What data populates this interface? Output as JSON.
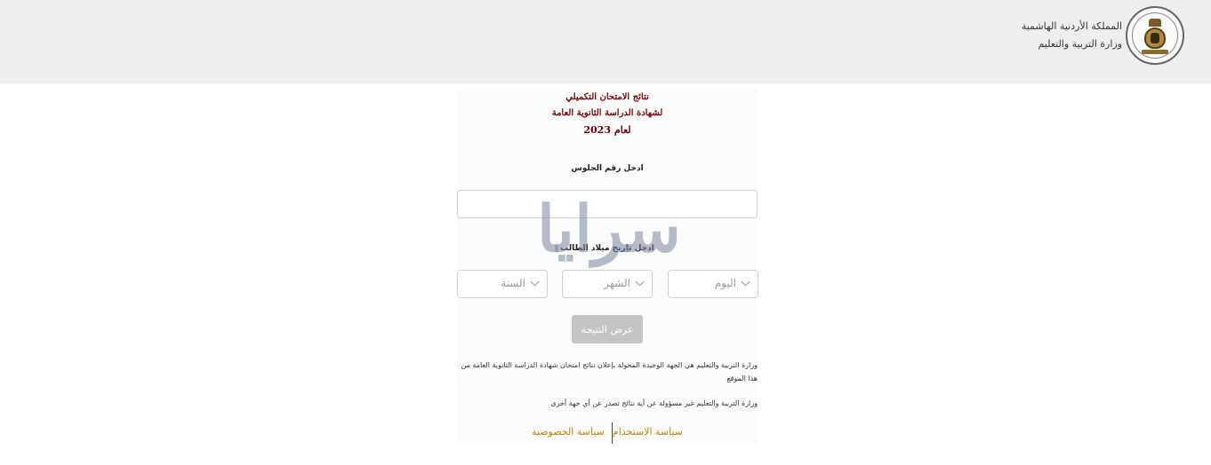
{
  "header": {
    "org_line1": "المملكة الأردنية الهاشمية",
    "org_line2": "وزارة التربية والتعليم"
  },
  "title": {
    "line1": "نتائج الامتحان التكميلي",
    "line2": "لشهادة الدراسة الثانوية العامة",
    "line3": "لعام 2023"
  },
  "form": {
    "seat_label": "ادخل رقم الجلوس",
    "seat_value": "",
    "dob_label": "ادخل تاريخ ميلاد الطالب",
    "day_placeholder": "اليوم",
    "month_placeholder": "الشهر",
    "year_placeholder": "السنة",
    "submit_label": "عرض النتيجة"
  },
  "notes": {
    "note1": "وزارة التربية والتعليم هي الجهة الوحيدة المخولة بإعلان نتائج امتحان شهادة الدراسة الثانوية العامة من هذا الموقع",
    "note2": "وزارة التربية والتعليم غير مسؤولة عن أية نتائج تصدر عن أي جهة أخرى"
  },
  "footer": {
    "terms_link": "سياسة الاستخدام",
    "privacy_link": "سياسة الخصوصية"
  },
  "watermark": "سرايا",
  "colors": {
    "title": "#7a0a0a",
    "link": "#b8860b",
    "header_bg": "#eeeeee",
    "button_bg": "#c4c4c4"
  }
}
